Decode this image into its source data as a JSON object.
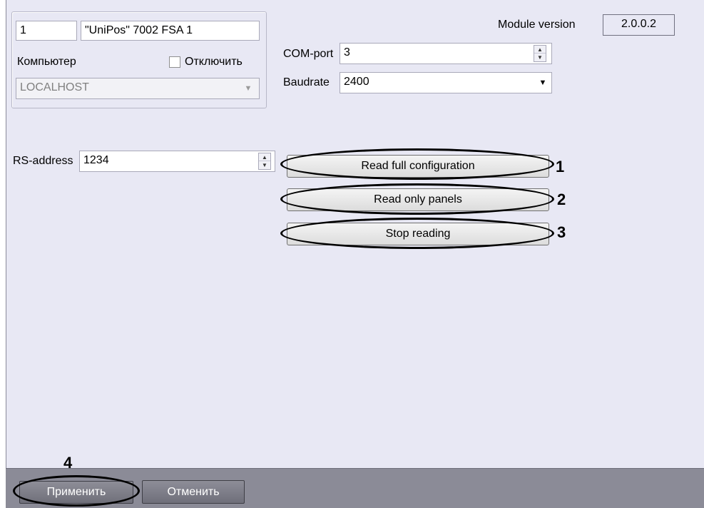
{
  "object": {
    "id": "1",
    "name": "\"UniPos\" 7002 FSA 1",
    "computer_label": "Компьютер",
    "disable_label": "Отключить",
    "computer_value": "LOCALHOST"
  },
  "module_version": {
    "label": "Module version",
    "value": "2.0.0.2"
  },
  "com_port": {
    "label": "COM-port",
    "value": "3"
  },
  "baudrate": {
    "label": "Baudrate",
    "value": "2400"
  },
  "rs_address": {
    "label": "RS-address",
    "value": "1234"
  },
  "buttons": {
    "read_full": "Read full configuration",
    "read_panels": "Read only panels",
    "stop_reading": "Stop reading",
    "apply": "Применить",
    "cancel": "Отменить"
  },
  "callouts": [
    "1",
    "2",
    "3",
    "4"
  ],
  "icons": {
    "spin": "spin-up-down-icon",
    "dropdown": "chevron-down-icon"
  }
}
